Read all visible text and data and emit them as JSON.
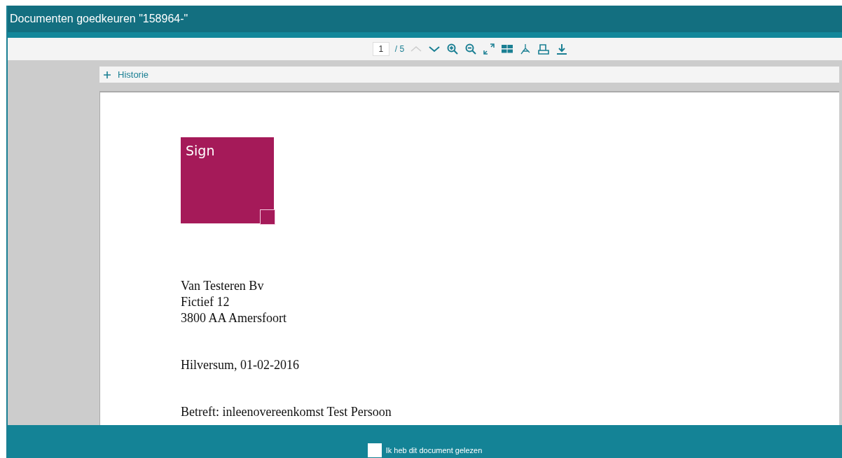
{
  "window": {
    "title": "Documenten goedkeuren \"158964-\""
  },
  "toolbar": {
    "page_value": "1",
    "page_total": "/ 5"
  },
  "history": {
    "label": "Historie",
    "expanded": false
  },
  "document": {
    "logo_text": "Sign",
    "address": [
      "Van Testeren Bv",
      "Fictief 12",
      "3800 AA Amersfoort"
    ],
    "date": "Hilversum, 01-02-2016",
    "subject": "Betreft: inleenovereenkomst Test Persoon"
  },
  "footer": {
    "confirm": {
      "label": "Ik heb dit document gelezen",
      "checked": false
    }
  }
}
